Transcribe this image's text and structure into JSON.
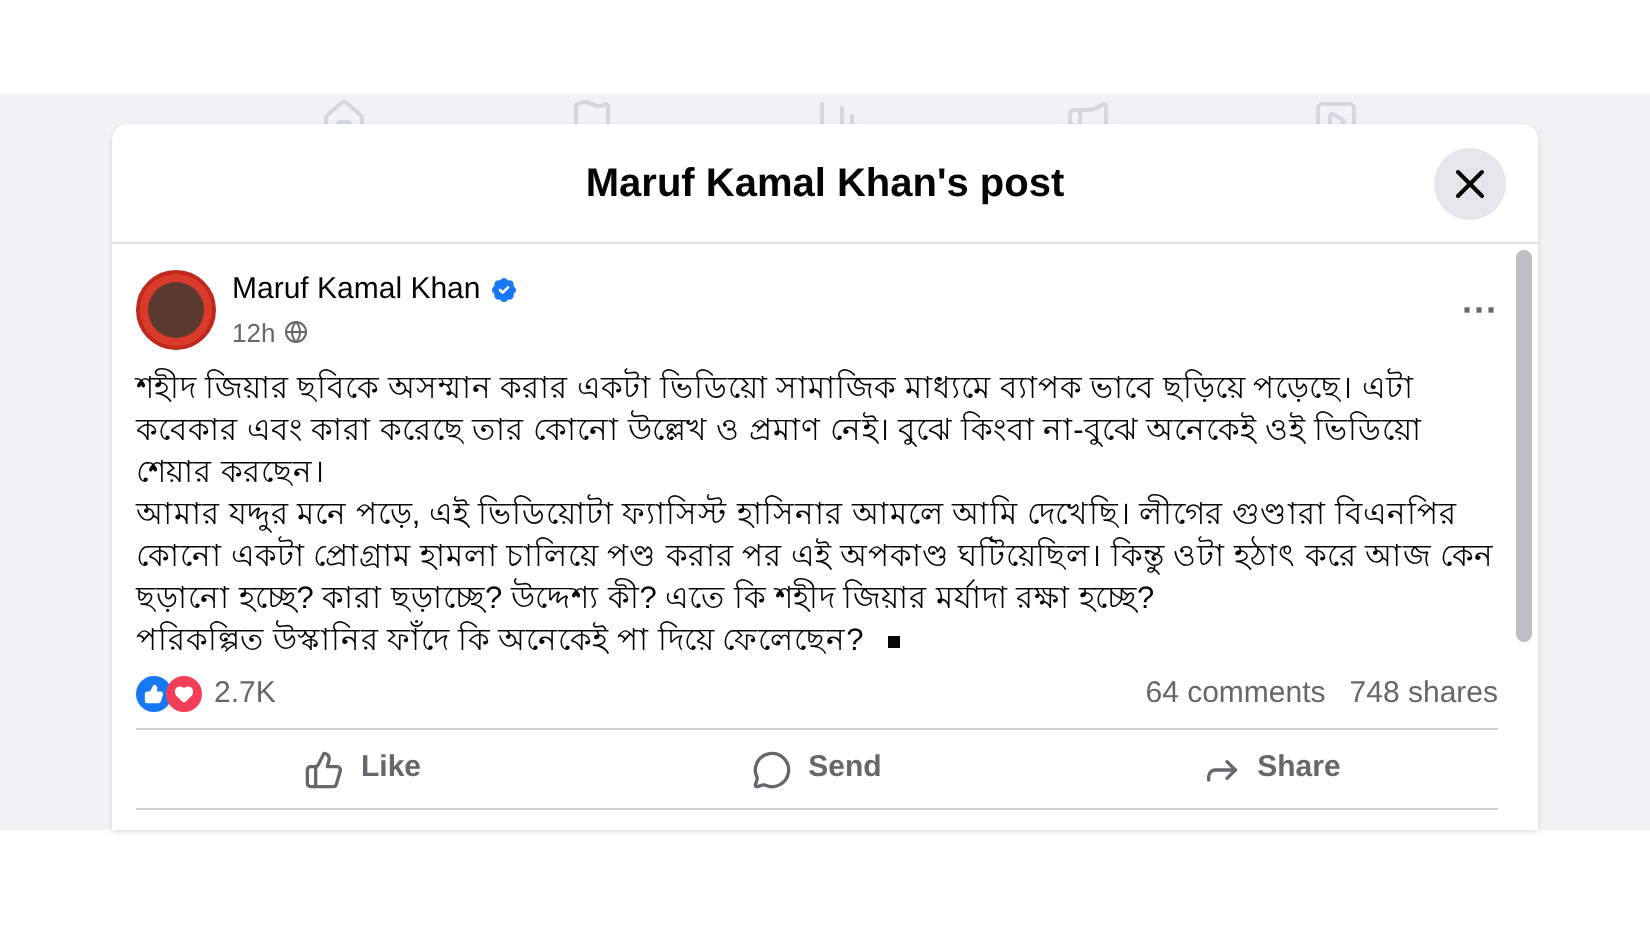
{
  "dialog": {
    "title": "Maruf Kamal Khan's post"
  },
  "post": {
    "author": "Maruf Kamal Khan",
    "verified": true,
    "time": "12h",
    "menu": "···",
    "paragraphs": [
      "শহীদ জিয়ার ছবিকে অসম্মান করার একটা ভিডিয়ো সামাজিক মাধ্যমে ব্যাপক ভাবে ছড়িয়ে পড়েছে। এটা কবেকার এবং কারা করেছে তার কোনো উল্লেখ ও প্রমাণ নেই। বুঝে কিংবা না-বুঝে অনেকেই ওই ভিডিয়ো শেয়ার করছেন।",
      "আমার যদ্দুর মনে পড়ে, এই ভিডিয়োটা ফ্যাসিস্ট হাসিনার আমলে আমি দেখেছি। লীগের গুণ্ডারা বিএনপির কোনো একটা প্রোগ্রাম হামলা চালিয়ে পণ্ড করার পর এই অপকাণ্ড ঘটিয়েছিল। কিন্তু ওটা হঠাৎ করে আজ কেন ছড়ানো হচ্ছে? কারা ছড়াচ্ছে? উদ্দেশ্য কী? এতে কি শহীদ জিয়ার মর্যাদা রক্ষা হচ্ছে?",
      "পরিকল্পিত উস্কানির ফাঁদে কি অনেকেই পা দিয়ে ফেলেছেন?"
    ],
    "reactions": "2.7K",
    "comments": "64 comments",
    "shares": "748 shares"
  },
  "actions": [
    {
      "kind": "like",
      "label": "Like"
    },
    {
      "kind": "send",
      "label": "Send"
    },
    {
      "kind": "share",
      "label": "Share"
    }
  ]
}
